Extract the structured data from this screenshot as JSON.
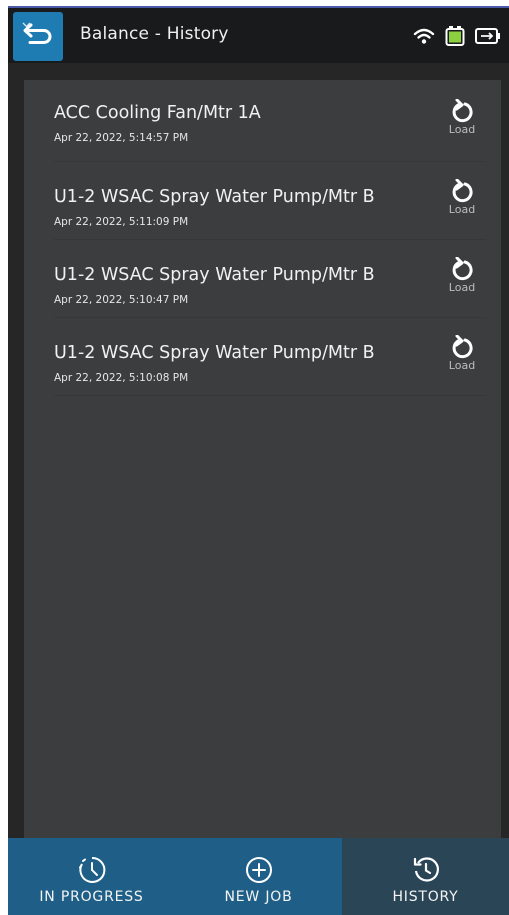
{
  "header": {
    "title": "Balance - History",
    "back_icon": "back-arrow-icon",
    "status_icons": [
      "wifi-icon",
      "battery-icon",
      "charging-battery-icon"
    ]
  },
  "history": {
    "load_label": "Load",
    "items": [
      {
        "name": "ACC Cooling Fan/Mtr 1A",
        "date": "Apr 22, 2022, 5:14:57 PM"
      },
      {
        "name": "U1-2 WSAC Spray Water Pump/Mtr B",
        "date": "Apr 22, 2022, 5:11:09 PM"
      },
      {
        "name": "U1-2 WSAC Spray Water Pump/Mtr B",
        "date": "Apr 22, 2022, 5:10:47 PM"
      },
      {
        "name": "U1-2 WSAC Spray Water Pump/Mtr B",
        "date": "Apr 22, 2022, 5:10:08 PM"
      }
    ]
  },
  "nav": {
    "in_progress": "IN PROGRESS",
    "new_job": "NEW JOB",
    "history": "HISTORY",
    "active": "history"
  },
  "colors": {
    "accent": "#1f7cb3",
    "nav_background": "#1f5f87",
    "nav_active": "#2a4656",
    "battery_green": "#8ccf3f"
  }
}
